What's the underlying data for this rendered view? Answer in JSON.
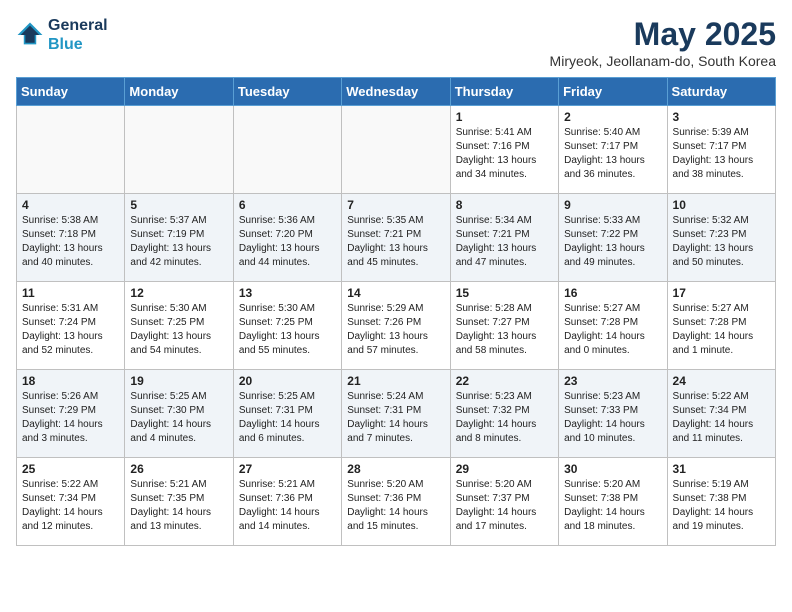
{
  "logo": {
    "line1": "General",
    "line2": "Blue"
  },
  "title": "May 2025",
  "location": "Miryeok, Jeollanam-do, South Korea",
  "days_of_week": [
    "Sunday",
    "Monday",
    "Tuesday",
    "Wednesday",
    "Thursday",
    "Friday",
    "Saturday"
  ],
  "weeks": [
    [
      {
        "day": "",
        "info": ""
      },
      {
        "day": "",
        "info": ""
      },
      {
        "day": "",
        "info": ""
      },
      {
        "day": "",
        "info": ""
      },
      {
        "day": "1",
        "info": "Sunrise: 5:41 AM\nSunset: 7:16 PM\nDaylight: 13 hours\nand 34 minutes."
      },
      {
        "day": "2",
        "info": "Sunrise: 5:40 AM\nSunset: 7:17 PM\nDaylight: 13 hours\nand 36 minutes."
      },
      {
        "day": "3",
        "info": "Sunrise: 5:39 AM\nSunset: 7:17 PM\nDaylight: 13 hours\nand 38 minutes."
      }
    ],
    [
      {
        "day": "4",
        "info": "Sunrise: 5:38 AM\nSunset: 7:18 PM\nDaylight: 13 hours\nand 40 minutes."
      },
      {
        "day": "5",
        "info": "Sunrise: 5:37 AM\nSunset: 7:19 PM\nDaylight: 13 hours\nand 42 minutes."
      },
      {
        "day": "6",
        "info": "Sunrise: 5:36 AM\nSunset: 7:20 PM\nDaylight: 13 hours\nand 44 minutes."
      },
      {
        "day": "7",
        "info": "Sunrise: 5:35 AM\nSunset: 7:21 PM\nDaylight: 13 hours\nand 45 minutes."
      },
      {
        "day": "8",
        "info": "Sunrise: 5:34 AM\nSunset: 7:21 PM\nDaylight: 13 hours\nand 47 minutes."
      },
      {
        "day": "9",
        "info": "Sunrise: 5:33 AM\nSunset: 7:22 PM\nDaylight: 13 hours\nand 49 minutes."
      },
      {
        "day": "10",
        "info": "Sunrise: 5:32 AM\nSunset: 7:23 PM\nDaylight: 13 hours\nand 50 minutes."
      }
    ],
    [
      {
        "day": "11",
        "info": "Sunrise: 5:31 AM\nSunset: 7:24 PM\nDaylight: 13 hours\nand 52 minutes."
      },
      {
        "day": "12",
        "info": "Sunrise: 5:30 AM\nSunset: 7:25 PM\nDaylight: 13 hours\nand 54 minutes."
      },
      {
        "day": "13",
        "info": "Sunrise: 5:30 AM\nSunset: 7:25 PM\nDaylight: 13 hours\nand 55 minutes."
      },
      {
        "day": "14",
        "info": "Sunrise: 5:29 AM\nSunset: 7:26 PM\nDaylight: 13 hours\nand 57 minutes."
      },
      {
        "day": "15",
        "info": "Sunrise: 5:28 AM\nSunset: 7:27 PM\nDaylight: 13 hours\nand 58 minutes."
      },
      {
        "day": "16",
        "info": "Sunrise: 5:27 AM\nSunset: 7:28 PM\nDaylight: 14 hours\nand 0 minutes."
      },
      {
        "day": "17",
        "info": "Sunrise: 5:27 AM\nSunset: 7:28 PM\nDaylight: 14 hours\nand 1 minute."
      }
    ],
    [
      {
        "day": "18",
        "info": "Sunrise: 5:26 AM\nSunset: 7:29 PM\nDaylight: 14 hours\nand 3 minutes."
      },
      {
        "day": "19",
        "info": "Sunrise: 5:25 AM\nSunset: 7:30 PM\nDaylight: 14 hours\nand 4 minutes."
      },
      {
        "day": "20",
        "info": "Sunrise: 5:25 AM\nSunset: 7:31 PM\nDaylight: 14 hours\nand 6 minutes."
      },
      {
        "day": "21",
        "info": "Sunrise: 5:24 AM\nSunset: 7:31 PM\nDaylight: 14 hours\nand 7 minutes."
      },
      {
        "day": "22",
        "info": "Sunrise: 5:23 AM\nSunset: 7:32 PM\nDaylight: 14 hours\nand 8 minutes."
      },
      {
        "day": "23",
        "info": "Sunrise: 5:23 AM\nSunset: 7:33 PM\nDaylight: 14 hours\nand 10 minutes."
      },
      {
        "day": "24",
        "info": "Sunrise: 5:22 AM\nSunset: 7:34 PM\nDaylight: 14 hours\nand 11 minutes."
      }
    ],
    [
      {
        "day": "25",
        "info": "Sunrise: 5:22 AM\nSunset: 7:34 PM\nDaylight: 14 hours\nand 12 minutes."
      },
      {
        "day": "26",
        "info": "Sunrise: 5:21 AM\nSunset: 7:35 PM\nDaylight: 14 hours\nand 13 minutes."
      },
      {
        "day": "27",
        "info": "Sunrise: 5:21 AM\nSunset: 7:36 PM\nDaylight: 14 hours\nand 14 minutes."
      },
      {
        "day": "28",
        "info": "Sunrise: 5:20 AM\nSunset: 7:36 PM\nDaylight: 14 hours\nand 15 minutes."
      },
      {
        "day": "29",
        "info": "Sunrise: 5:20 AM\nSunset: 7:37 PM\nDaylight: 14 hours\nand 17 minutes."
      },
      {
        "day": "30",
        "info": "Sunrise: 5:20 AM\nSunset: 7:38 PM\nDaylight: 14 hours\nand 18 minutes."
      },
      {
        "day": "31",
        "info": "Sunrise: 5:19 AM\nSunset: 7:38 PM\nDaylight: 14 hours\nand 19 minutes."
      }
    ]
  ]
}
